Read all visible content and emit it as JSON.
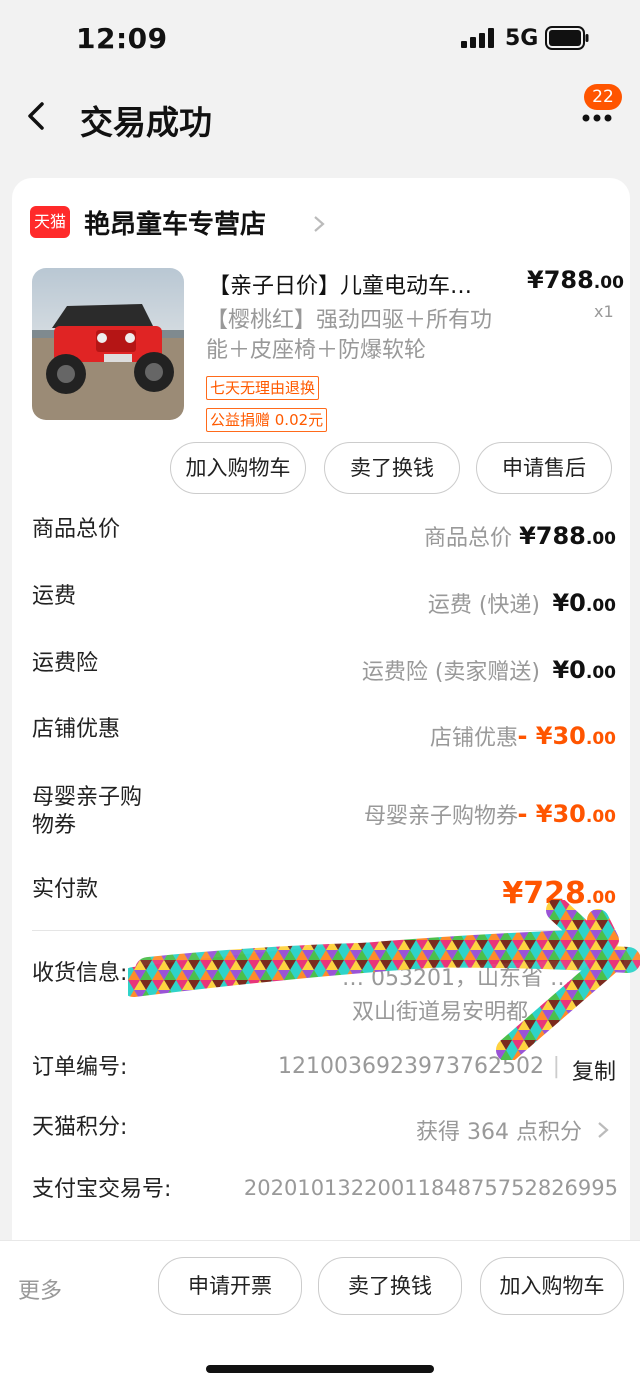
{
  "status_bar": {
    "time": "12:09",
    "network": "5G"
  },
  "nav": {
    "title": "交易成功",
    "badge_count": "22"
  },
  "store": {
    "logo_text": "天猫",
    "name": "艳昂童车专营店"
  },
  "product": {
    "title": "【亲子日价】儿童电动车…",
    "price_main": "¥788",
    "price_cents": ".00",
    "quantity": "x1",
    "spec": "【樱桃红】强劲四驱＋所有功能＋皮座椅＋防爆软轮",
    "tags": [
      "七天无理由退换",
      "公益捐赠 0.02元"
    ],
    "actions": [
      "加入购物车",
      "卖了换钱",
      "申请售后"
    ]
  },
  "price_rows": [
    {
      "label": "商品总价",
      "desc": "商品总价",
      "amount": "¥788",
      "cents": ".00"
    },
    {
      "label": "运费",
      "desc": "运费 (快递)",
      "amount": "¥0",
      "cents": ".00"
    },
    {
      "label": "运费险",
      "desc": "运费险 (卖家赠送)",
      "amount": "¥0",
      "cents": ".00"
    },
    {
      "label": "店铺优惠",
      "desc": "店铺优惠",
      "amount": "- ¥30",
      "cents": ".00"
    },
    {
      "label": "母婴亲子购物券",
      "desc": "母婴亲子购物券",
      "amount": "- ¥30",
      "cents": ".00"
    }
  ],
  "paid": {
    "label": "实付款",
    "amount": "¥728",
    "cents": ".00"
  },
  "info": {
    "shipping_label": "收货信息:",
    "shipping_partial_1": "… 053201，山东省 …",
    "shipping_partial_2": "双山街道易安明都",
    "order_label": "订单编号:",
    "order_no": "1210036923973762502",
    "copy": "复制",
    "points_label": "天猫积分:",
    "points_value": "获得 364 点积分",
    "alipay_label": "支付宝交易号:",
    "alipay_no": "2020101322001184875752826995"
  },
  "bottom_bar": {
    "more": "更多",
    "buttons": [
      "申请开票",
      "卖了换钱",
      "加入购物车"
    ]
  },
  "colors": {
    "accent": "#ff5500",
    "tmall_red": "#ff2a2a"
  }
}
